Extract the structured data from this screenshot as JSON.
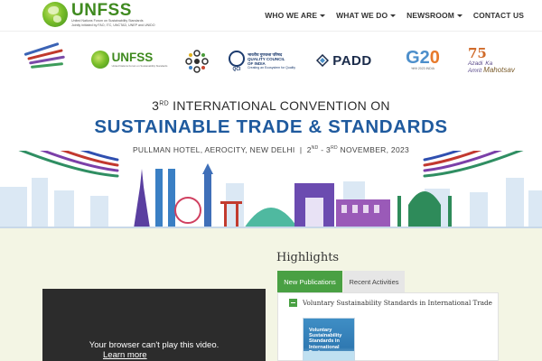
{
  "header": {
    "logo_title": "UNFSS",
    "logo_subtitle": "United Nations Forum on Sustainability Standards",
    "logo_tagline": "Jointly initiated by FAO, ITC, UNCTAD, UNEP and UNIDO",
    "nav": [
      {
        "label": "WHO WE ARE",
        "dropdown": true
      },
      {
        "label": "WHAT WE DO",
        "dropdown": true
      },
      {
        "label": "NEWSROOM",
        "dropdown": true
      },
      {
        "label": "CONTACT US",
        "dropdown": false
      }
    ]
  },
  "partners": {
    "unfss_title": "UNFSS",
    "unfss_sub": "United Nations Forum on Sustainability Standards",
    "qci_line1": "भारतीय गुणवत्ता परिषद",
    "qci_line2": "QUALITY COUNCIL",
    "qci_line3": "OF INDIA",
    "qci_tagline": "Creating an Ecosystem for Quality",
    "qci_abbr": "QCI",
    "padd": "PADD",
    "g20_tagline": "भारत 2023 INDIA",
    "azadi_number": "75",
    "azadi_word": "Azadi",
    "azadi_ka": "Ka",
    "azadi_amrit": "Amrit",
    "azadi_mahotsav": "Mahotsav"
  },
  "banner": {
    "ordinal_num": "3",
    "ordinal_sup": "RD",
    "line1_rest": " INTERNATIONAL CONVENTION ON",
    "line2": "SUSTAINABLE TRADE & STANDARDS",
    "venue": "PULLMAN HOTEL, AEROCITY, NEW DELHI  |  ",
    "date_day1": "2",
    "date_sup1": "ND",
    "date_sep": " - 3",
    "date_sup2": "RD",
    "date_rest": " NOVEMBER, 2023"
  },
  "highlights": {
    "title": "Highlights",
    "tabs": [
      {
        "label": "New Publications",
        "active": true
      },
      {
        "label": "Recent Activities",
        "active": false
      }
    ],
    "publication_title": "Voluntary Sustainability Standards in International Trade",
    "cover_text": "Voluntary Sustainability Standards in International Trade"
  },
  "video": {
    "message": "Your browser can't play this video.",
    "link": "Learn more"
  },
  "colors": {
    "brand_green": "#3f8a1f",
    "tab_green": "#49a043",
    "banner_blue": "#1f5a9e",
    "section_bg": "#f3f5e4"
  }
}
